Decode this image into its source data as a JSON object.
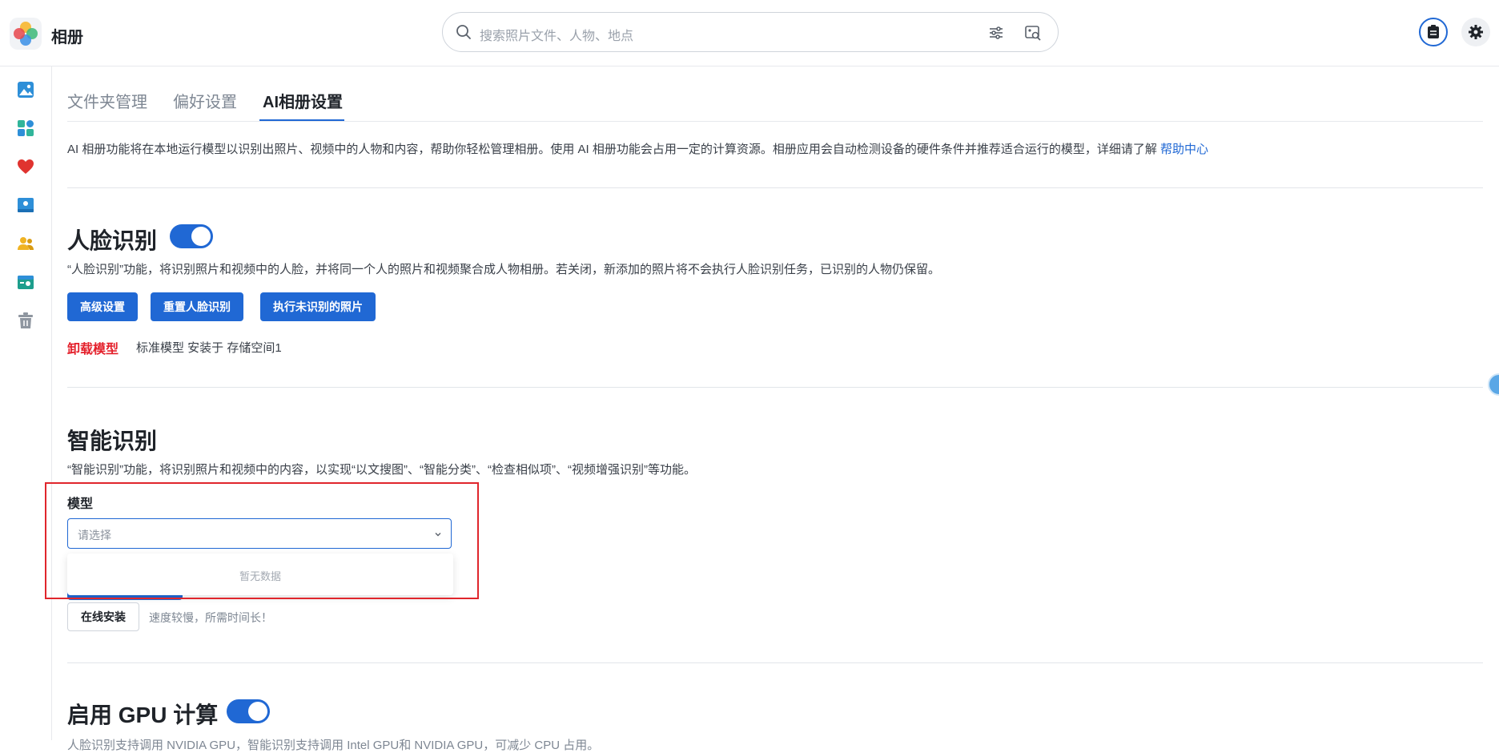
{
  "app": {
    "title": "相册"
  },
  "search": {
    "placeholder": "搜索照片文件、人物、地点"
  },
  "sidebar": {
    "items": [
      {
        "icon": "photos-icon",
        "color": "#2e8fd8"
      },
      {
        "icon": "albums-icon",
        "color": "#31b59a"
      },
      {
        "icon": "favorites-icon",
        "color": "#e0332f"
      },
      {
        "icon": "shared-album-icon",
        "color": "#2e8fd8"
      },
      {
        "icon": "people-icon",
        "color": "#f0b323"
      },
      {
        "icon": "shared-space-icon",
        "color": "#1d9e8c"
      },
      {
        "icon": "trash-icon",
        "color": "#8f96a0"
      }
    ]
  },
  "tabs": [
    {
      "label": "文件夹管理"
    },
    {
      "label": "偏好设置"
    },
    {
      "label": "AI相册设置"
    }
  ],
  "intro": {
    "text": "AI 相册功能将在本地运行模型以识别出照片、视频中的人物和内容，帮助你轻松管理相册。使用 AI 相册功能会占用一定的计算资源。相册应用会自动检测设备的硬件条件并推荐适合运行的模型，详细请了解 ",
    "link": "帮助中心"
  },
  "face": {
    "title": "人脸识别",
    "enabled": true,
    "description": "“人脸识别”功能，将识别照片和视频中的人脸，并将同一个人的照片和视频聚合成人物相册。若关闭，新添加的照片将不会执行人脸识别任务，已识别的人物仍保留。",
    "buttons": [
      "高级设置",
      "重置人脸识别",
      "执行未识别的照片"
    ],
    "uninstall_label": "卸载模型",
    "model_info": "标准模型 安装于 存储空间1"
  },
  "smart": {
    "title": "智能识别",
    "description": "“智能识别”功能，将识别照片和视频中的内容，以实现“以文搜图”、“智能分类”、“检查相似项”、“视频增强识别”等功能。",
    "model_label": "模型",
    "select_placeholder": "请选择",
    "empty_text": "暂无数据",
    "online_install": "在线安装",
    "install_note": "速度较慢，所需时间长！"
  },
  "gpu": {
    "title": "启用 GPU 计算",
    "enabled": true,
    "description": "人脸识别支持调用 NVIDIA GPU，智能识别支持调用 Intel GPU和 NVIDIA GPU，可减少 CPU 占用。"
  }
}
